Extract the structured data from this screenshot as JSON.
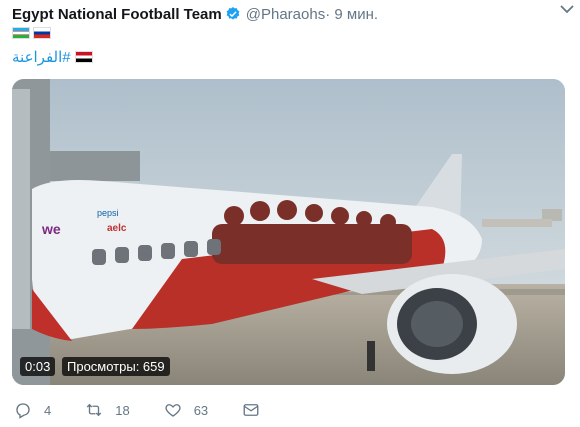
{
  "tweet": {
    "author": "Egypt National Football Team",
    "handle": "@Pharaohs",
    "time": " · 9 мин.",
    "flags": [
      "flag-uzbekistan",
      "flag-russia"
    ],
    "hashtag": "#الفراعنة",
    "hashtag_flag": "flag-egypt"
  },
  "video": {
    "duration": "0:03",
    "views": "Просмотры: 659"
  },
  "actions": {
    "replies": "4",
    "retweets": "18",
    "likes": "63"
  },
  "colors": {
    "link": "#1b95e0",
    "muted": "#657786",
    "verified": "#1da1f2"
  }
}
